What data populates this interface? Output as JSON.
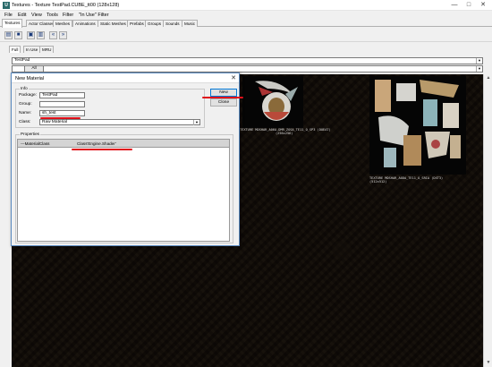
{
  "window": {
    "title": "Textures - Texture TestPad.CUBE_tt00 (128x128)",
    "min": "—",
    "max": "□",
    "close": "✕"
  },
  "menu": [
    "File",
    "Edit",
    "View",
    "Tools",
    "Filter",
    "\"In Use\" Filter"
  ],
  "tabs": [
    "Textures",
    "Actor Classes",
    "Meshes",
    "Animations",
    "Static Meshes",
    "Prefabs",
    "Groups",
    "Sounds",
    "Music"
  ],
  "subtabs": [
    "Full",
    "In Use",
    "MRU"
  ],
  "package_combo": "TestPad",
  "group_all_button": "All",
  "textures": [
    {
      "label1": "TEXTURE MDSHAR_A06A.DMR_ZOSA_TE11_O_SP3 (DOEAT)",
      "label2": "(256x256)"
    },
    {
      "label1": "TEXTURE MDSHAR_A0DA_TE11_O_SRIA (DXT3)",
      "label2": "(512x512)"
    }
  ],
  "dialog": {
    "title": "New Material",
    "info_group": "Info",
    "package_label": "Package:",
    "package_value": "TestPad",
    "group_label": "Group:",
    "group_value": "",
    "name_label": "Name:",
    "name_value": "sh_test",
    "class_label": "Class:",
    "class_value": "Raw Material",
    "new_button": "New",
    "close_button": "Close",
    "properties_group": "Properties",
    "property_name": "---MaterialClass",
    "property_value": "Class'Engine.Shader'"
  },
  "colors": {
    "annotation_red": "#e0101a",
    "dialog_border": "#5a8ac0"
  }
}
